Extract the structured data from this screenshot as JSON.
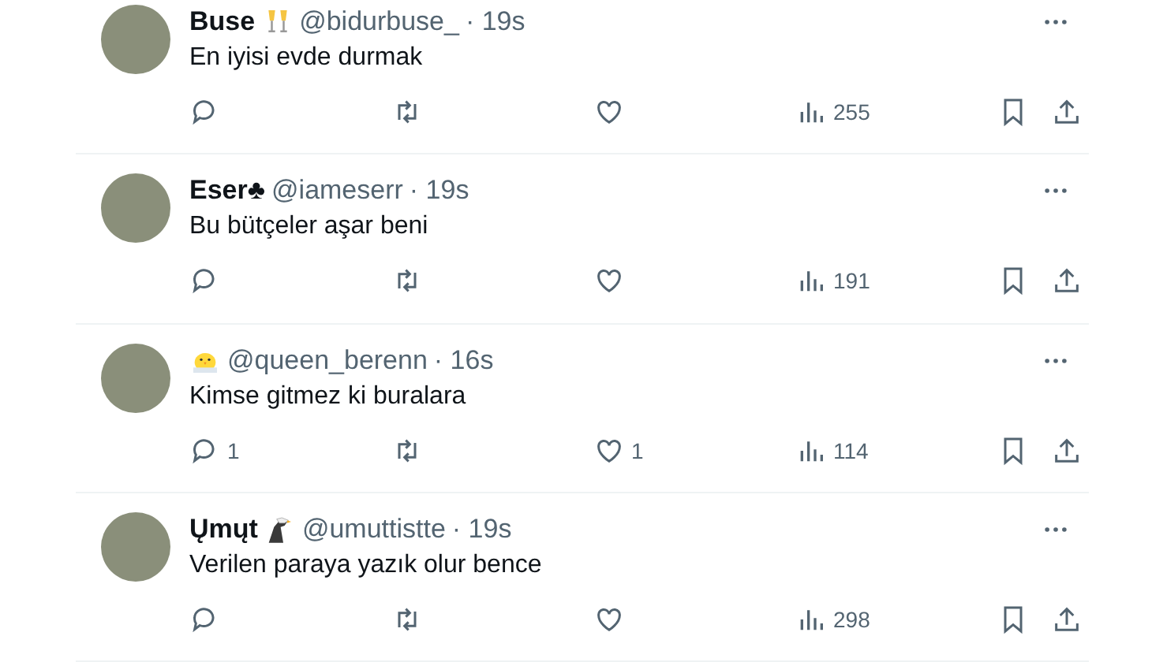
{
  "tweets": [
    {
      "name": "Buse",
      "badge": {
        "kind": "glasses"
      },
      "handle": "@bidurbuse_",
      "time": "· 19s",
      "text": "En iyisi evde durmak",
      "views": "255"
    },
    {
      "name": "Eser♣",
      "handle": "@iameserr",
      "time": "· 19s",
      "text": "Bu bütçeler aşar beni",
      "views": "191"
    },
    {
      "badge": {
        "kind": "chick"
      },
      "handle": "@queen_berenn",
      "time": "· 16s",
      "text": "Kimse gitmez ki buralara",
      "replies": "1",
      "likes": "1",
      "views": "114"
    },
    {
      "name": "Ųmųt",
      "badge": {
        "kind": "eagle"
      },
      "handle": "@umuttistte",
      "time": "· 19s",
      "text": "Verilen paraya yazık olur bence",
      "views": "298"
    }
  ]
}
